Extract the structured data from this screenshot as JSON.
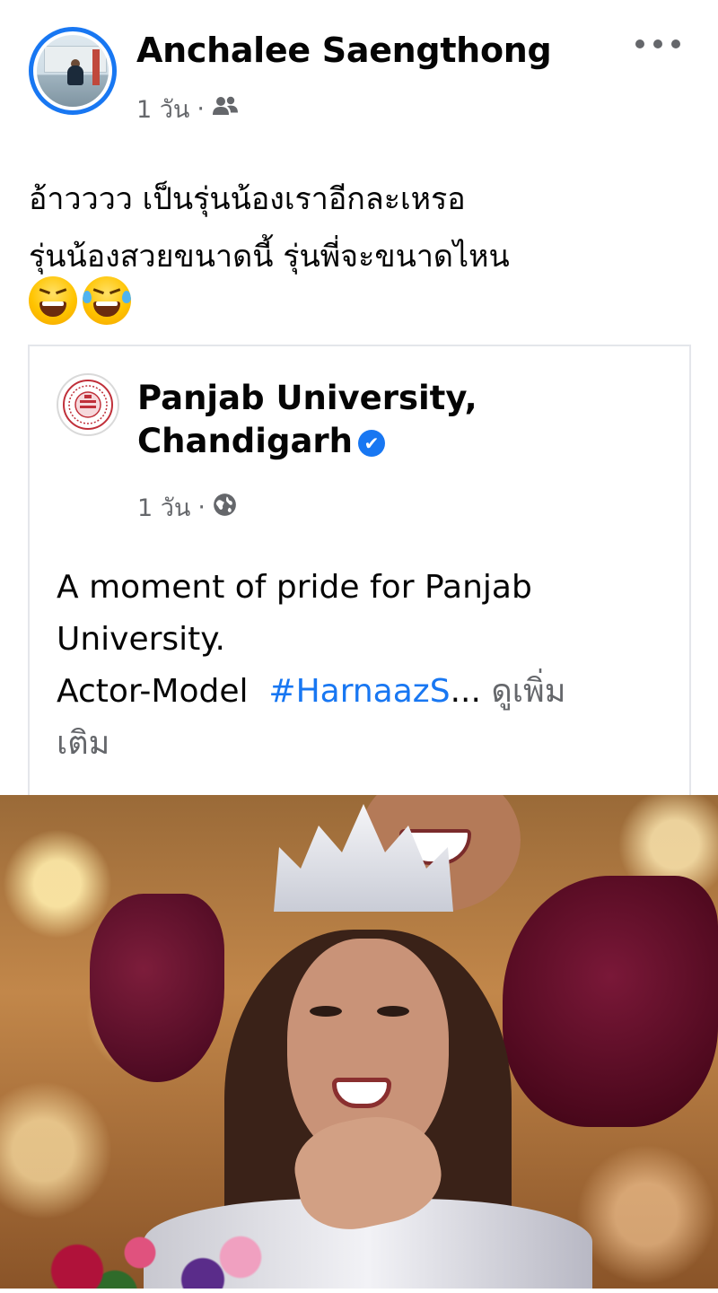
{
  "post": {
    "author": "Anchalee Saengthong",
    "time": "1 วัน",
    "separator": "·",
    "audience_icon": "friends-icon",
    "text_line1": "อ้าวววว เป็นรุ่นน้องเราอีกละเหรอ",
    "text_line2": "รุ่นน้องสวยขนาดนี้ รุ่นพี่จะขนาดไหน",
    "emojis": [
      "laughing-squint-emoji",
      "tears-of-joy-emoji"
    ]
  },
  "shared": {
    "page_name_line1": "Panjab University,",
    "page_name_line2": "Chandigarh",
    "verified_icon": "verified-badge-icon",
    "time": "1 วัน",
    "separator": "·",
    "audience_icon": "globe-icon",
    "text_line1": "A moment of pride for Panjab",
    "text_line2": "University.",
    "text_line3_prefix": "Actor-Model",
    "hashtag": "#HarnaazS",
    "ellipsis": "...",
    "see_more_part1": "ดูเพิ่ม",
    "see_more_part2": "เติม"
  },
  "colors": {
    "accent": "#1877f2",
    "meta_text": "#65676b",
    "primary_text": "#050505",
    "card_border": "#e4e6eb"
  }
}
